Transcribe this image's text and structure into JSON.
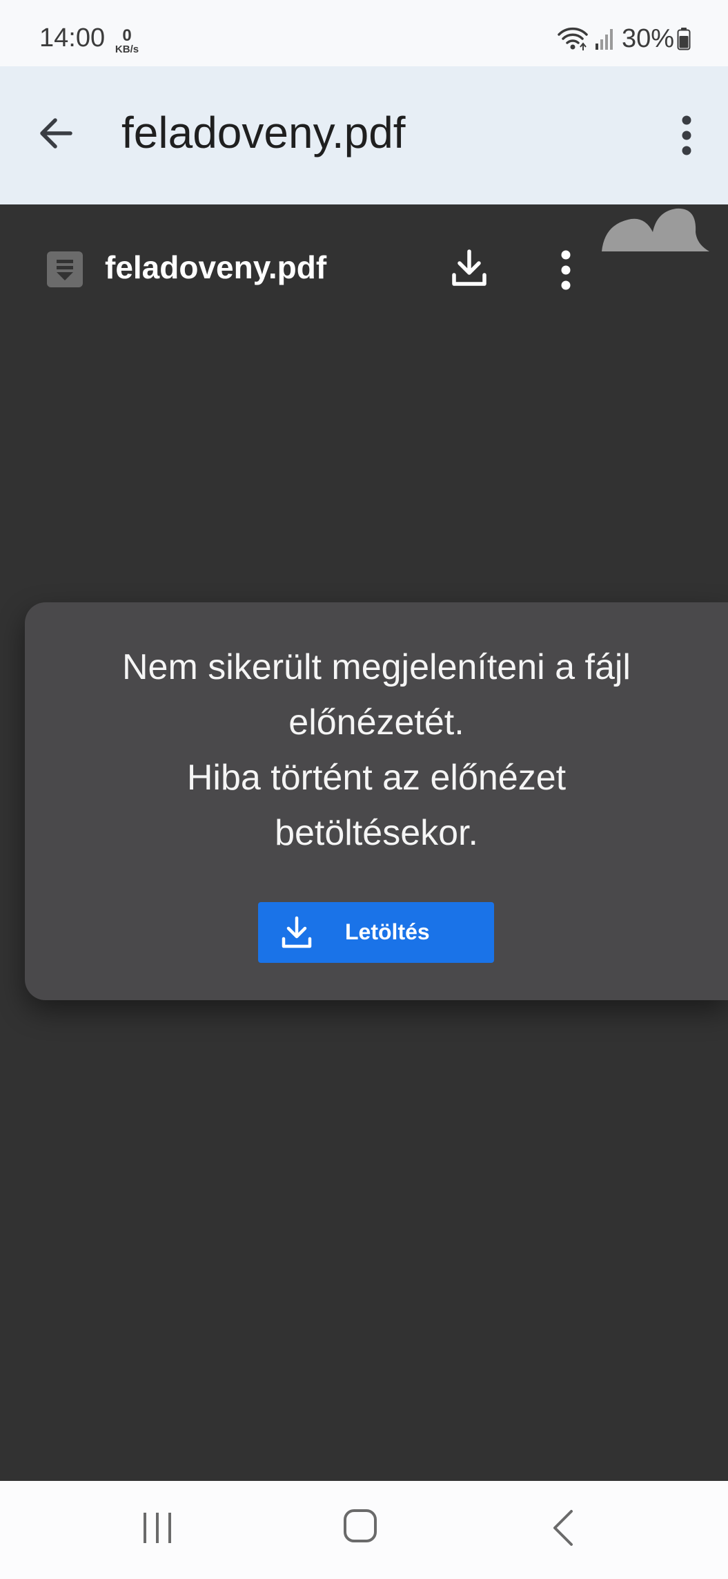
{
  "status_bar": {
    "time": "14:00",
    "net_speed_value": "0",
    "net_speed_unit": "KB/s",
    "battery_percent": "30%",
    "icons": [
      "wifi-icon",
      "signal-icon",
      "battery-icon"
    ]
  },
  "app_bar": {
    "title": "feladoveny.pdf",
    "icons": [
      "back-arrow-icon",
      "more-vert-icon"
    ]
  },
  "viewer": {
    "file_name": "feladoveny.pdf",
    "icons": [
      "document-icon",
      "download-icon",
      "more-vert-icon"
    ]
  },
  "dialog": {
    "message_line1": "Nem sikerült megjeleníteni a fájl",
    "message_line2": "előnézetét.",
    "message_line3": "Hiba történt az előnézet",
    "message_line4": "betöltésekor.",
    "button_label": "Letöltés"
  },
  "colors": {
    "status_bg": "#f8f9fb",
    "app_bar_bg": "#e7eef5",
    "viewer_bg": "#323232",
    "dialog_bg": "#4a494b",
    "accent": "#1a73e8"
  },
  "nav_bar": {
    "icons": [
      "recents-icon",
      "home-icon",
      "back-icon"
    ]
  }
}
